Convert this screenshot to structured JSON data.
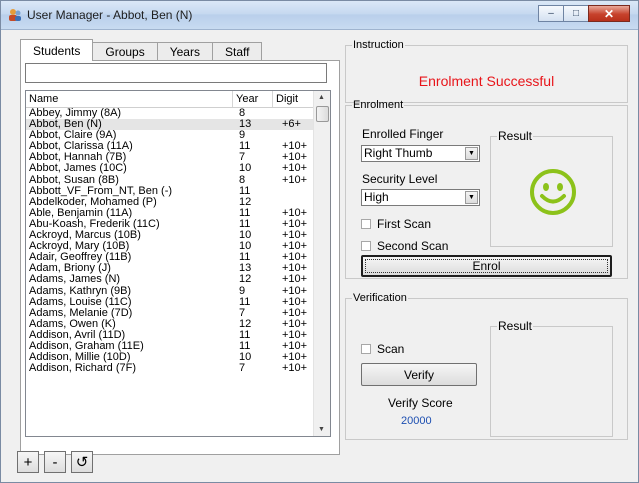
{
  "window": {
    "title": "User Manager - Abbot, Ben (N)",
    "minimize": "–",
    "maximize": "□",
    "close": "✕"
  },
  "tabs": [
    {
      "label": "Students"
    },
    {
      "label": "Groups"
    },
    {
      "label": "Years"
    },
    {
      "label": "Staff"
    }
  ],
  "search": {
    "value": ""
  },
  "list": {
    "headers": {
      "name": "Name",
      "year": "Year",
      "digit": "Digit"
    },
    "rows": [
      {
        "name": "Abbey, Jimmy (8A)",
        "year": "8",
        "digit": ""
      },
      {
        "name": "Abbot, Ben (N)",
        "year": "13",
        "digit": "+6+"
      },
      {
        "name": "Abbot, Claire (9A)",
        "year": "9",
        "digit": ""
      },
      {
        "name": "Abbot, Clarissa (11A)",
        "year": "11",
        "digit": "+10+"
      },
      {
        "name": "Abbot, Hannah (7B)",
        "year": "7",
        "digit": "+10+"
      },
      {
        "name": "Abbot, James (10C)",
        "year": "10",
        "digit": "+10+"
      },
      {
        "name": "Abbot, Susan (8B)",
        "year": "8",
        "digit": "+10+"
      },
      {
        "name": "Abbott_VF_From_NT, Ben (-)",
        "year": "11",
        "digit": ""
      },
      {
        "name": "Abdelkoder, Mohamed (P)",
        "year": "12",
        "digit": ""
      },
      {
        "name": "Able, Benjamin (11A)",
        "year": "11",
        "digit": "+10+"
      },
      {
        "name": "Abu-Koash, Frederik (11C)",
        "year": "11",
        "digit": "+10+"
      },
      {
        "name": "Ackroyd, Marcus (10B)",
        "year": "10",
        "digit": "+10+"
      },
      {
        "name": "Ackroyd, Mary (10B)",
        "year": "10",
        "digit": "+10+"
      },
      {
        "name": "Adair, Geoffrey (11B)",
        "year": "11",
        "digit": "+10+"
      },
      {
        "name": "Adam, Briony (J)",
        "year": "13",
        "digit": "+10+"
      },
      {
        "name": "Adams, James (N)",
        "year": "12",
        "digit": "+10+"
      },
      {
        "name": "Adams, Kathryn (9B)",
        "year": "9",
        "digit": "+10+"
      },
      {
        "name": "Adams, Louise (11C)",
        "year": "11",
        "digit": "+10+"
      },
      {
        "name": "Adams, Melanie (7D)",
        "year": "7",
        "digit": "+10+"
      },
      {
        "name": "Adams, Owen (K)",
        "year": "12",
        "digit": "+10+"
      },
      {
        "name": "Addison, Avril (11D)",
        "year": "11",
        "digit": "+10+"
      },
      {
        "name": "Addison, Graham (11E)",
        "year": "11",
        "digit": "+10+"
      },
      {
        "name": "Addison, Millie (10D)",
        "year": "10",
        "digit": "+10+"
      },
      {
        "name": "Addison, Richard (7F)",
        "year": "7",
        "digit": "+10+"
      }
    ],
    "selected_index": 1
  },
  "bottom_buttons": {
    "add": "+",
    "remove": "-",
    "refresh": "↺"
  },
  "instruction": {
    "legend": "Instruction",
    "message": "Enrolment Successful",
    "message_color": "#e8151a"
  },
  "enrolment": {
    "legend": "Enrolment",
    "finger_label": "Enrolled Finger",
    "finger_value": "Right Thumb",
    "security_label": "Security Level",
    "security_value": "High",
    "first_scan": "First Scan",
    "second_scan": "Second Scan",
    "result_label": "Result",
    "result_icon": "smiley-face",
    "result_color": "#8cc21a",
    "enrol_button": "Enrol"
  },
  "verification": {
    "legend": "Verification",
    "scan": "Scan",
    "verify_button": "Verify",
    "score_label": "Verify Score",
    "score_value": "20000",
    "result_label": "Result"
  }
}
